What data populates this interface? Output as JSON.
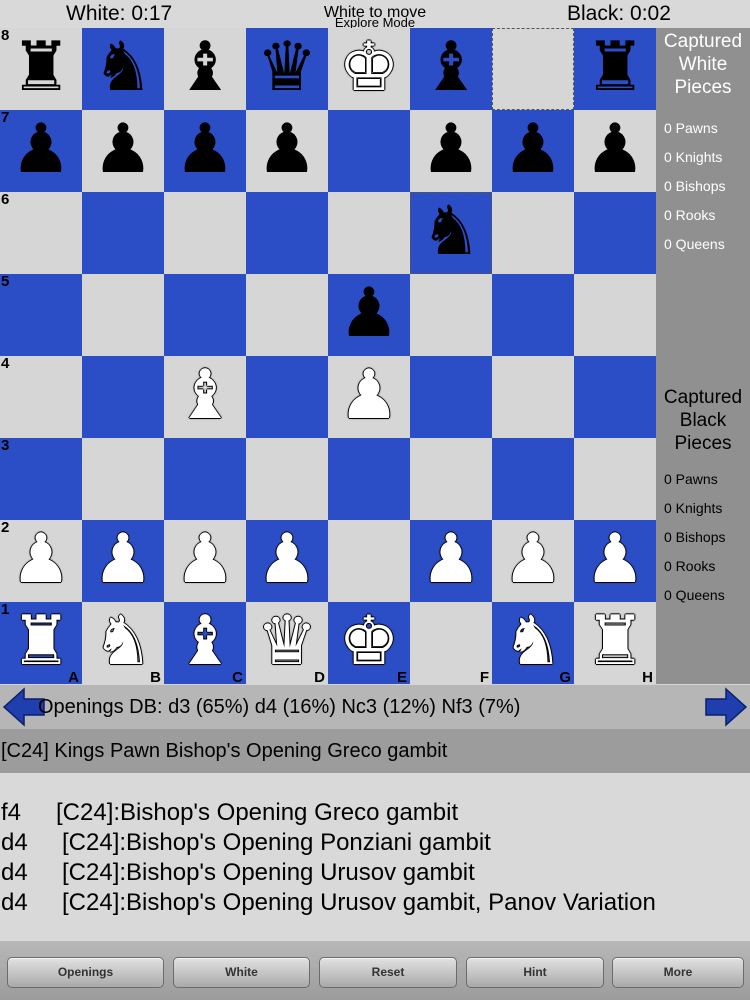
{
  "header": {
    "white_clock": "White: 0:17",
    "black_clock": "Black: 0:02",
    "turn_status": "White to move",
    "mode_status": "Explore Mode"
  },
  "board": {
    "light_color": "#d6d6d6",
    "dark_color": "#2b4ec6",
    "ranks": [
      "8",
      "7",
      "6",
      "5",
      "4",
      "3",
      "2",
      "1"
    ],
    "files": [
      "A",
      "B",
      "C",
      "D",
      "E",
      "F",
      "G",
      "H"
    ],
    "rows": [
      [
        "br",
        "bn",
        "bb",
        "bq",
        "wk",
        "bb",
        "",
        "br"
      ],
      [
        "bp",
        "bp",
        "bp",
        "bp",
        "",
        "bp",
        "bp",
        "bp"
      ],
      [
        "",
        "",
        "",
        "",
        "",
        "bn",
        "",
        ""
      ],
      [
        "",
        "",
        "",
        "",
        "bp",
        "",
        "",
        ""
      ],
      [
        "",
        "",
        "wb",
        "",
        "wp",
        "",
        "",
        ""
      ],
      [
        "",
        "",
        "",
        "",
        "",
        "",
        "",
        ""
      ],
      [
        "wp",
        "wp",
        "wp",
        "wp",
        "",
        "wp",
        "wp",
        "wp"
      ],
      [
        "wr",
        "wn",
        "wb",
        "wq",
        "wk",
        "",
        "wn",
        "wr"
      ]
    ],
    "highlighted_squares": [
      "g8",
      "f6"
    ]
  },
  "captured": {
    "white_title": [
      "Captured",
      "White",
      "Pieces"
    ],
    "white_items": [
      "0 Pawns",
      "0 Knights",
      "0 Bishops",
      "0 Rooks",
      "0 Queens"
    ],
    "black_title": [
      "Captured",
      "Black",
      "Pieces"
    ],
    "black_items": [
      "0 Pawns",
      "0 Knights",
      "0 Bishops",
      "0 Rooks",
      "0 Queens"
    ]
  },
  "openings": {
    "db_text": "Openings DB: d3 (65%) d4 (16%) Nc3 (12%) Nf3 (7%)",
    "prev_icon": "left-arrow-icon",
    "next_icon": "right-arrow-icon",
    "current_name": "[C24] Kings Pawn Bishop's Opening Greco gambit",
    "variations": [
      {
        "move": "f4",
        "desc": "[C24]:Bishop's Opening Greco gambit"
      },
      {
        "move": "d4",
        "desc": "[C24]:Bishop's Opening Ponziani gambit"
      },
      {
        "move": "d4",
        "desc": "[C24]:Bishop's Opening Urusov gambit"
      },
      {
        "move": "d4",
        "desc": "[C24]:Bishop's Opening Urusov gambit, Panov Variation"
      }
    ]
  },
  "toolbar": {
    "openings_label": "Openings",
    "white_label": "White",
    "reset_label": "Reset",
    "hint_label": "Hint",
    "more_label": "More"
  }
}
